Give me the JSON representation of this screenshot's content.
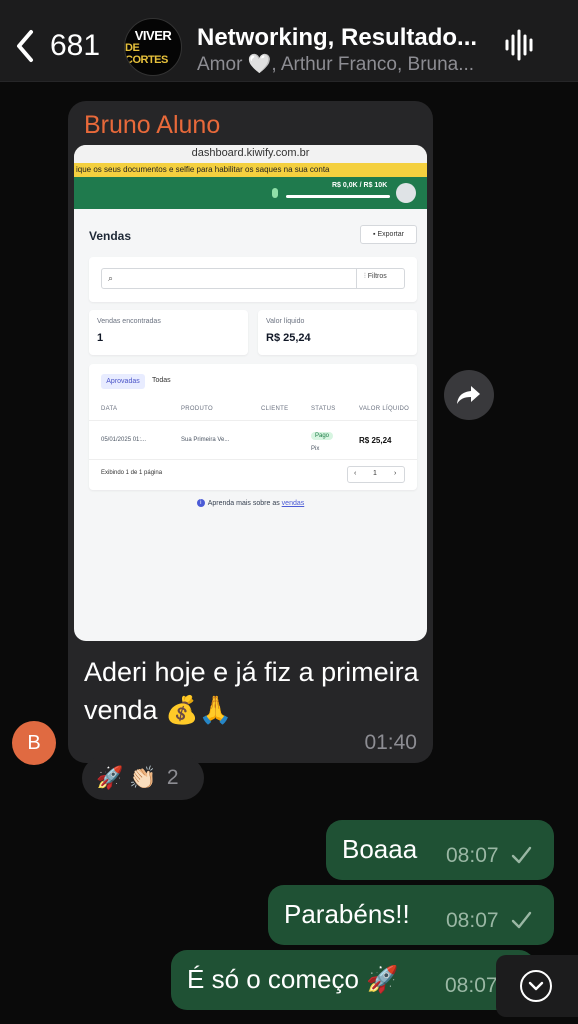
{
  "header": {
    "unread_count": "681",
    "group_avatar_line1": "VIVER",
    "group_avatar_line2": "DE CORTES",
    "title": "Networking, Resultado...",
    "subtitle": "Amor 🤍, Arthur Franco, Bruna..."
  },
  "incoming": {
    "sender": "Bruno Aluno",
    "text": "Aderi hoje e já fiz a primeira venda 💰🙏",
    "time": "01:40",
    "sender_initial": "B",
    "reactions": {
      "emoji1": "🚀",
      "emoji2": "👏🏻",
      "count": "2"
    },
    "screenshot": {
      "url": "dashboard.kiwify.com.br",
      "warning": "ique os seus documentos e selfie para habilitar os saques na sua conta",
      "progress": "R$ 0,0K / R$ 10K",
      "heading": "Vendas",
      "export_label": "Exportar",
      "filter_label": "Filtros",
      "stat1_label": "Vendas encontradas",
      "stat1_value": "1",
      "stat2_label": "Valor líquido",
      "stat2_value": "R$ 25,24",
      "tab_active": "Aprovadas",
      "tab_other": "Todas",
      "columns": [
        "DATA",
        "PRODUTO",
        "CLIENTE",
        "STATUS",
        "VALOR LÍQUIDO"
      ],
      "row": {
        "date": "05/01/2025 01:...",
        "product": "Sua Primeira Ve...",
        "status": "Pago",
        "method": "Pix",
        "value": "R$ 25,24"
      },
      "pager_text": "Exibindo 1 de 1 página",
      "page": "1",
      "learn_prefix": "Aprenda mais sobre as",
      "learn_link": "vendas"
    }
  },
  "outgoing": [
    {
      "text": "Boaaa",
      "time": "08:07"
    },
    {
      "text": "Parabéns!!",
      "time": "08:07"
    },
    {
      "text": "É só o começo 🚀",
      "time": "08:07"
    }
  ],
  "colors": {
    "sender": "#e8693a",
    "outgoing_bubble": "#1f5134",
    "incoming_bubble": "#262628"
  }
}
